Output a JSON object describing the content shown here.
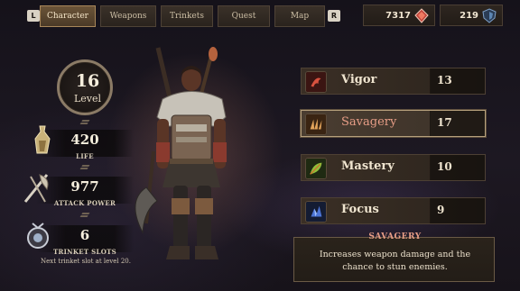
{
  "topbar": {
    "left_key": "L",
    "right_key": "R",
    "tabs": [
      {
        "label": "Character",
        "active": true
      },
      {
        "label": "Weapons",
        "active": false
      },
      {
        "label": "Trinkets",
        "active": false
      },
      {
        "label": "Quest",
        "active": false
      },
      {
        "label": "Map",
        "active": false
      }
    ],
    "currencies": [
      {
        "value": "7317",
        "icon": "red-gem-icon"
      },
      {
        "value": "219",
        "icon": "blue-shield-gem-icon"
      }
    ]
  },
  "stats": {
    "level_value": "16",
    "level_label": "Level",
    "life_value": "420",
    "life_label": "LIFE",
    "attack_value": "977",
    "attack_label": "ATTACK POWER",
    "trinket_value": "6",
    "trinket_label": "TRINKET SLOTS",
    "trinket_note": "Next trinket slot at level 20."
  },
  "attributes": [
    {
      "name": "Vigor",
      "value": "13",
      "icon": "vigor-icon",
      "selected": false
    },
    {
      "name": "Savagery",
      "value": "17",
      "icon": "savagery-claw-icon",
      "selected": true
    },
    {
      "name": "Mastery",
      "value": "10",
      "icon": "mastery-leaf-icon",
      "selected": false
    },
    {
      "name": "Focus",
      "value": "9",
      "icon": "focus-crystal-icon",
      "selected": false
    }
  ],
  "description": {
    "title": "SAVAGERY",
    "text": "Increases weapon damage and the chance to stun enemies."
  },
  "colors": {
    "accent_salmon": "#e79d86",
    "panel_gold_border": "#b6a07c"
  }
}
